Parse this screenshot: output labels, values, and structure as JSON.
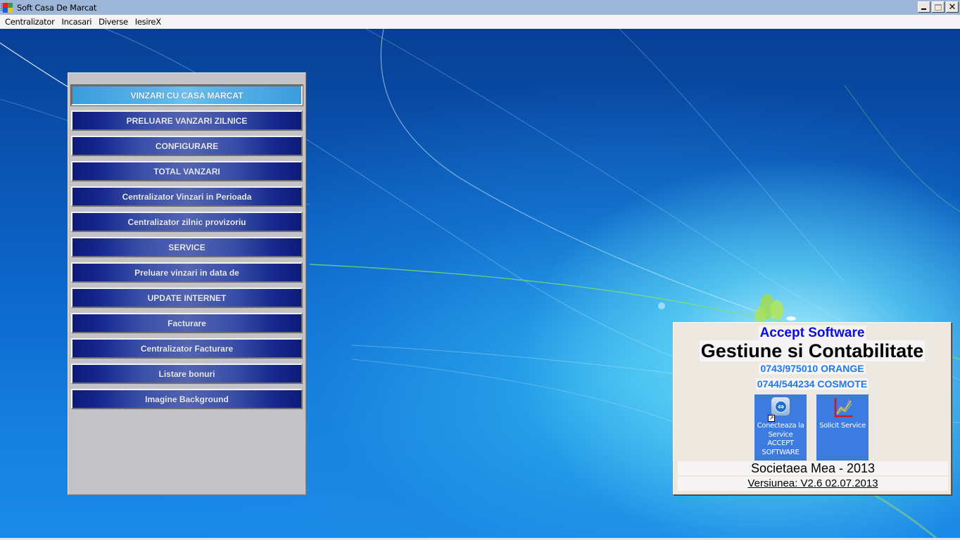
{
  "window": {
    "title": "Soft Casa De Marcat",
    "controls": {
      "minimize": "minimize",
      "maximize": "maximize",
      "close": "✕"
    }
  },
  "menubar": {
    "items": [
      {
        "label": "Centralizator"
      },
      {
        "label": "Incasari"
      },
      {
        "label": "Diverse"
      },
      {
        "label": "IesireX"
      }
    ]
  },
  "main_menu": {
    "buttons": [
      {
        "label": "VINZARI CU CASA MARCAT",
        "active": true
      },
      {
        "label": "PRELUARE VANZARI ZILNICE"
      },
      {
        "label": "CONFIGURARE"
      },
      {
        "label": "TOTAL VANZARI"
      },
      {
        "label": "Centralizator Vinzari in Perioada"
      },
      {
        "label": "Centralizator zilnic provizoriu"
      },
      {
        "label": "SERVICE"
      },
      {
        "label": "Preluare vinzari in data de"
      },
      {
        "label": "UPDATE INTERNET"
      },
      {
        "label": "Facturare"
      },
      {
        "label": "Centralizator Facturare"
      },
      {
        "label": "Listare bonuri"
      },
      {
        "label": "Imagine Background"
      }
    ]
  },
  "info": {
    "brand": "Accept Software",
    "product": "Gestiune si Contabilitate",
    "phone_orange": "0743/975010 ORANGE",
    "phone_cosmote": "0744/544234 COSMOTE",
    "shortcuts": [
      {
        "label": "Conecteaza la Service ACCEPT SOFTWARE",
        "icon": "teamviewer-icon"
      },
      {
        "label": "Solicit Service",
        "icon": "chart-icon"
      }
    ],
    "company": "Societaea Mea - 2013",
    "version": "Versiunea: V2.6 02.07.2013"
  },
  "colors": {
    "button_dark": "#0c1a7a",
    "button_active": "#5db5e8",
    "brand_blue": "#0a0ae6",
    "phone_blue": "#1f7ae8",
    "titlebar": "#9db5d6"
  }
}
